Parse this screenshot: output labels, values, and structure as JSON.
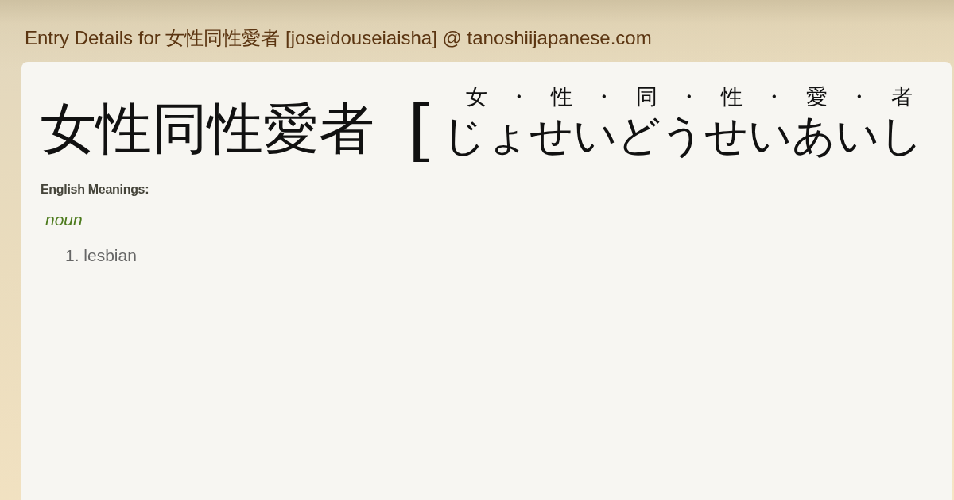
{
  "page_title": "Entry Details for 女性同性愛者 [joseidouseiaisha] @ tanoshiijapanese.com",
  "entry": {
    "headword": "女性同性愛者",
    "reading_open_bracket": "[",
    "furigana": "女・性・同・性・愛・者",
    "reading": "じょせいどうせいあいし",
    "meanings_label": "English Meanings:",
    "senses": [
      {
        "part_of_speech": "noun",
        "definitions": [
          {
            "number": "1.",
            "text": "lesbian"
          }
        ]
      }
    ]
  }
}
